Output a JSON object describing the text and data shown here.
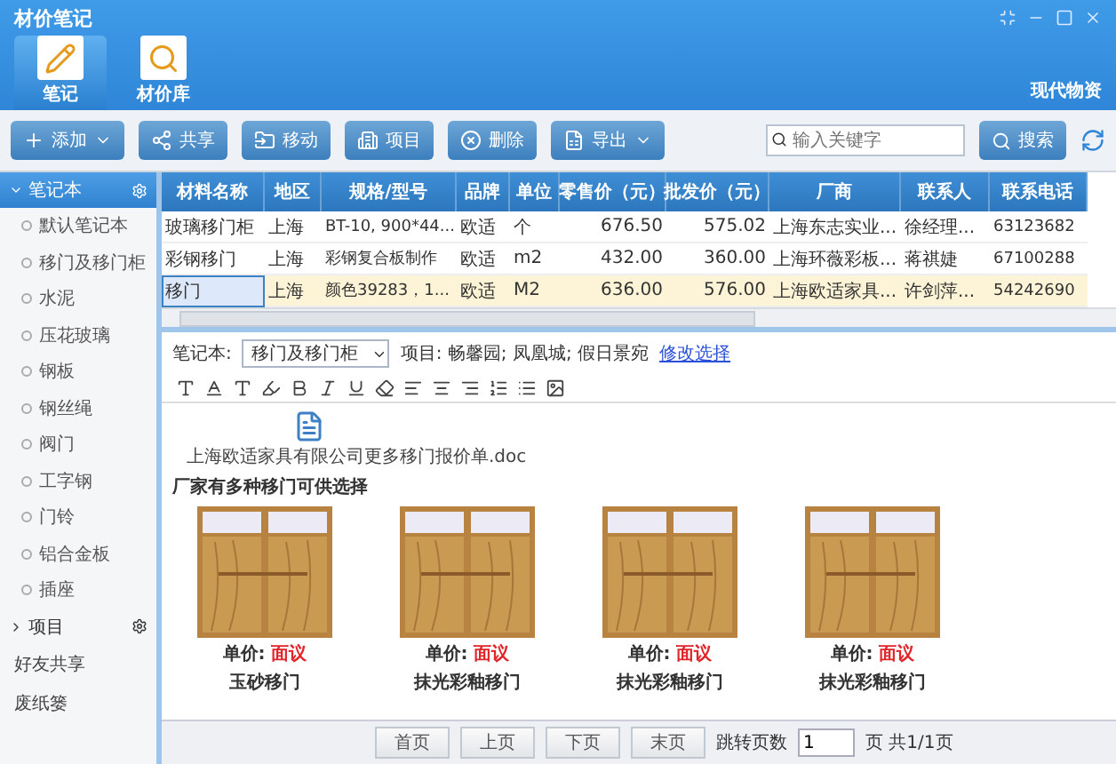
{
  "window": {
    "title": "材价笔记",
    "user": "现代物资"
  },
  "tabs": [
    {
      "label": "笔记",
      "selected": true,
      "kind": "note"
    },
    {
      "label": "材价库",
      "selected": false,
      "kind": "library"
    }
  ],
  "toolbar": {
    "buttons": [
      {
        "label": "添加",
        "kind": "add",
        "dropdown": true
      },
      {
        "label": "共享",
        "kind": "share",
        "dropdown": false
      },
      {
        "label": "移动",
        "kind": "move",
        "dropdown": false
      },
      {
        "label": "项目",
        "kind": "project",
        "dropdown": false
      },
      {
        "label": "删除",
        "kind": "delete",
        "dropdown": false
      },
      {
        "label": "导出",
        "kind": "export",
        "dropdown": true
      }
    ],
    "search": {
      "placeholder": "输入关键字"
    },
    "search_button": "搜索"
  },
  "sidebar": {
    "sections": [
      {
        "label": "笔记本",
        "expanded": true,
        "items": [
          "默认笔记本",
          "移门及移门柜",
          "水泥",
          "压花玻璃",
          "钢板",
          "钢丝绳",
          "阀门",
          "工字钢",
          "门铃",
          "铝合金板",
          "插座"
        ]
      },
      {
        "label": "项目",
        "expanded": false
      }
    ],
    "links": [
      "好友共享",
      "废纸篓"
    ]
  },
  "table": {
    "columns": [
      "材料名称",
      "地区",
      "规格/型号",
      "品牌",
      "单位",
      "零售价（元）",
      "批发价（元）",
      "厂商",
      "联系人",
      "联系电话"
    ],
    "rows": [
      {
        "selected": false,
        "cells": [
          "玻璃移门柜",
          "上海",
          "BT-10, 900*44...",
          "欧适",
          "个",
          "676.50",
          "575.02",
          "上海东志实业...",
          "徐经理...",
          "63123682"
        ]
      },
      {
        "selected": false,
        "cells": [
          "彩钢移门",
          "上海",
          "彩钢复合板制作",
          "欧适",
          "m2",
          "432.00",
          "360.00",
          "上海环薇彩板...",
          "蒋祺婕",
          "67100288"
        ]
      },
      {
        "selected": true,
        "cells": [
          "移门",
          "上海",
          "颜色39283，1...",
          "欧适",
          "M2",
          "636.00",
          "576.00",
          "上海欧适家具...",
          "许剑萍...",
          "54242690"
        ]
      }
    ]
  },
  "note": {
    "notebook_label": "笔记本:",
    "notebook_value": "移门及移门柜",
    "project_text": "项目: 畅馨园; 凤凰城; 假日景宛",
    "change_link": "修改选择",
    "attachment": "上海欧适家具有限公司更多移门报价单.doc",
    "heading": "厂家有多种移门可供选择",
    "products": [
      {
        "price_label": "单价:",
        "price": "面议",
        "name": "玉砂移门"
      },
      {
        "price_label": "单价:",
        "price": "面议",
        "name": "抹光彩釉移门"
      },
      {
        "price_label": "单价:",
        "price": "面议",
        "name": "抹光彩釉移门"
      },
      {
        "price_label": "单价:",
        "price": "面议",
        "name": "抹光彩釉移门"
      }
    ]
  },
  "pager": {
    "buttons": [
      "首页",
      "上页",
      "下页",
      "末页"
    ],
    "jump_label": "跳转页数",
    "page": "1",
    "total": "页 共1/1页"
  }
}
